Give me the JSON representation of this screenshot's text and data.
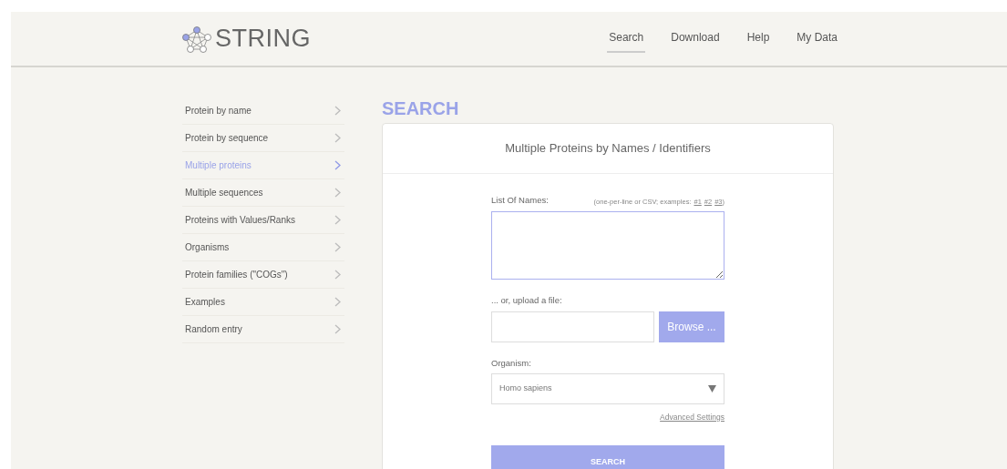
{
  "logo": {
    "text": "STRING"
  },
  "nav": [
    {
      "label": "Search",
      "selected": true
    },
    {
      "label": "Download",
      "selected": false
    },
    {
      "label": "Help",
      "selected": false
    },
    {
      "label": "My Data",
      "selected": false
    }
  ],
  "sidebar": {
    "items": [
      {
        "label": "Protein by name",
        "selected": false
      },
      {
        "label": "Protein by sequence",
        "selected": false
      },
      {
        "label": "Multiple proteins",
        "selected": true
      },
      {
        "label": "Multiple sequences",
        "selected": false
      },
      {
        "label": "Proteins with Values/Ranks",
        "selected": false
      },
      {
        "label": "Organisms",
        "selected": false
      },
      {
        "label": "Protein families (\"COGs\")",
        "selected": false
      },
      {
        "label": "Examples",
        "selected": false
      },
      {
        "label": "Random entry",
        "selected": false
      }
    ]
  },
  "page_title": "SEARCH",
  "panel": {
    "title": "Multiple Proteins by Names / Identifiers",
    "names_label": "List Of Names:",
    "names_hint": {
      "before": "(one-per-line or CSV; examples:",
      "examples": [
        "#1",
        "#2",
        "#3"
      ],
      "after": ")"
    },
    "upload_label": "... or, upload a file:",
    "browse_button": "Browse ...",
    "organism_label": "Organism:",
    "organism_value": "Homo sapiens",
    "advanced_link": "Advanced Settings",
    "search_button": "SEARCH"
  }
}
